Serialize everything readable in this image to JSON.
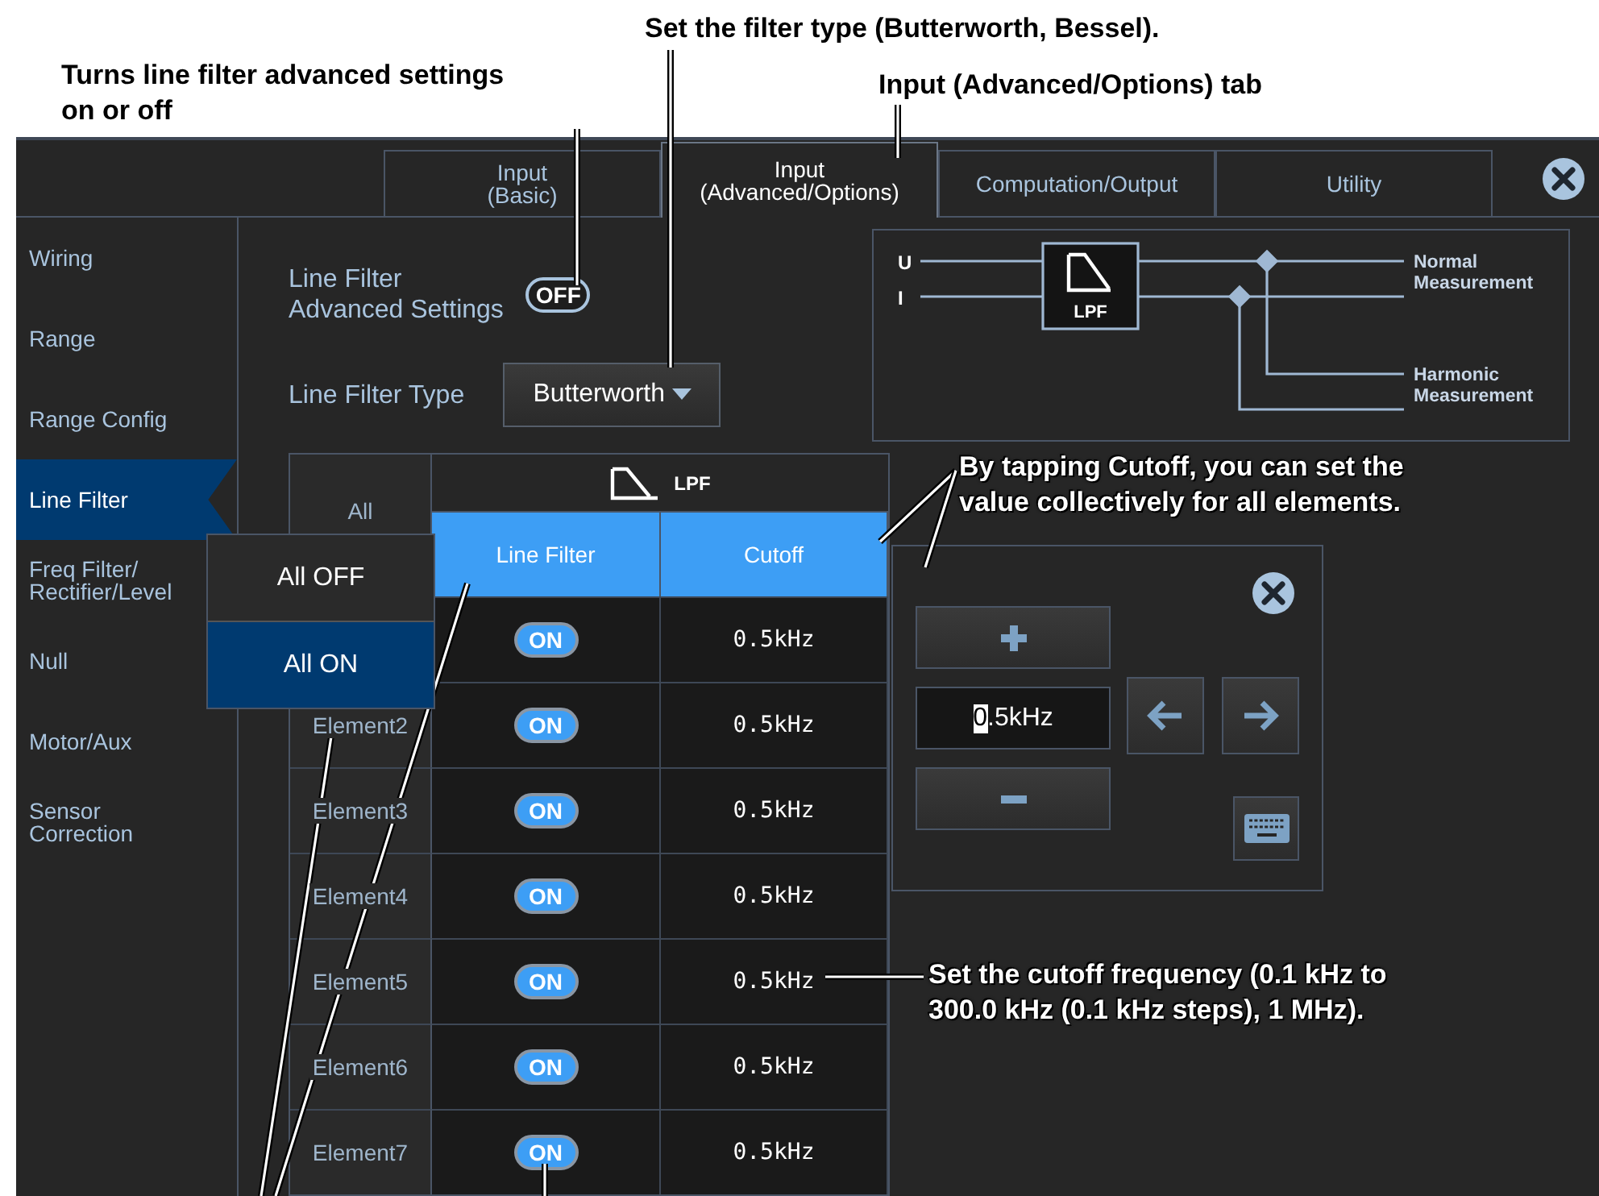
{
  "annotations": [
    {
      "kind": "top-left",
      "text": "Turns line filter advanced settings\non or off"
    },
    {
      "kind": "top-mid",
      "text": "Set the filter type (Butterworth, Bessel)."
    },
    {
      "kind": "top-right",
      "text": "Input (Advanced/Options) tab"
    },
    {
      "kind": "panel",
      "text": "By tapping Cutoff, you can set the\nvalue collectively for all elements."
    },
    {
      "kind": "cutoff",
      "text": "Set the cutoff frequency (0.1 kHz to\n300.0 kHz (0.1 kHz steps), 1 MHz)."
    }
  ],
  "tabs": [
    {
      "label": "Input\n(Basic)",
      "selected": false
    },
    {
      "label": "Input\n(Advanced/Options)",
      "selected": true
    },
    {
      "label": "Computation/Output",
      "selected": false
    },
    {
      "label": "Utility",
      "selected": false
    }
  ],
  "sidebar": {
    "items": [
      {
        "label": "Wiring",
        "selected": false
      },
      {
        "label": "Range",
        "selected": false
      },
      {
        "label": "Range Config",
        "selected": false
      },
      {
        "label": "Line Filter",
        "selected": true
      },
      {
        "label": "Freq Filter/\nRectifier/Level",
        "selected": false
      },
      {
        "label": "Null",
        "selected": false
      },
      {
        "label": "Motor/Aux",
        "selected": false
      },
      {
        "label": "Sensor\nCorrection",
        "selected": false
      }
    ]
  },
  "advanced_settings": {
    "label": "Line Filter\nAdvanced Settings",
    "toggle": "OFF",
    "on": false
  },
  "filter_type": {
    "label": "Line Filter Type",
    "value": "Butterworth"
  },
  "diagram": {
    "inputs": [
      "U",
      "I"
    ],
    "block": "LPF",
    "outputs": [
      "Normal\nMeasurement",
      "Harmonic\nMeasurement"
    ]
  },
  "table": {
    "corner": "All",
    "group": "LPF",
    "columns": [
      {
        "label": "Line Filter",
        "selected": true
      },
      {
        "label": "Cutoff",
        "selected": true
      }
    ],
    "rows": [
      {
        "toggle": "ON",
        "on": true,
        "cutoff": "0.5kHz"
      },
      {
        "element": "Element2",
        "toggle": "ON",
        "on": true,
        "cutoff": "0.5kHz"
      },
      {
        "element": "Element3",
        "toggle": "ON",
        "on": true,
        "cutoff": "0.5kHz"
      },
      {
        "element": "Element4",
        "toggle": "ON",
        "on": true,
        "cutoff": "0.5kHz"
      },
      {
        "element": "Element5",
        "toggle": "ON",
        "on": true,
        "cutoff": "0.5kHz"
      },
      {
        "element": "Element6",
        "toggle": "ON",
        "on": true,
        "cutoff": "0.5kHz"
      },
      {
        "element": "Element7",
        "toggle": "ON",
        "on": true,
        "cutoff": "0.5kHz"
      }
    ]
  },
  "popup": {
    "items": [
      {
        "label": "All OFF",
        "selected": false
      },
      {
        "label": "All ON",
        "selected": true
      }
    ]
  },
  "cutoff_panel": {
    "value": "0.5kHz"
  }
}
